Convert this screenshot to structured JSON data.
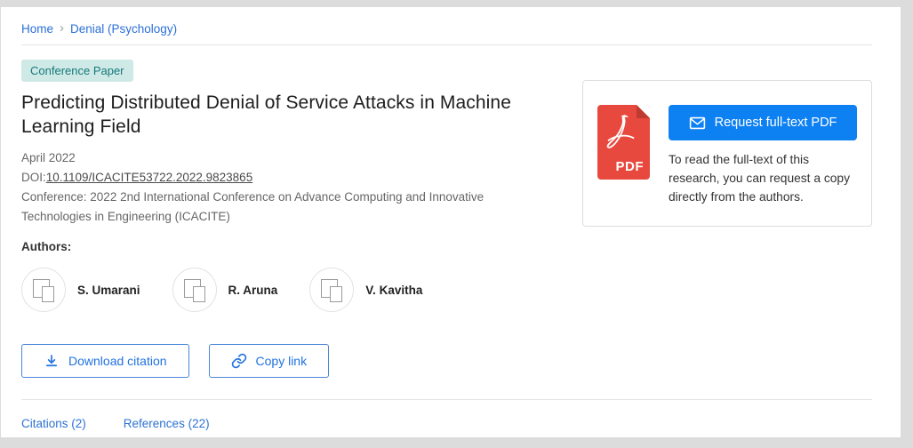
{
  "colors": {
    "link_blue": "#2b6fd8",
    "button_blue": "#0d80f2",
    "badge_bg": "#cfe9e6",
    "badge_text": "#15797b",
    "pdf_red": "#e8493e"
  },
  "breadcrumb": {
    "home": "Home",
    "topic": "Denial (Psychology)"
  },
  "badge": "Conference Paper",
  "paper": {
    "title": "Predicting Distributed Denial of Service Attacks in Machine Learning Field",
    "date": "April 2022",
    "doi_label": "DOI:",
    "doi": "10.1109/ICACITE53722.2022.9823865",
    "conference": "Conference: 2022 2nd International Conference on Advance Computing and Innovative Technologies in Engineering (ICACITE)"
  },
  "authors": {
    "label": "Authors:",
    "list": [
      {
        "name": "S. Umarani"
      },
      {
        "name": "R. Aruna"
      },
      {
        "name": "V. Kavitha"
      }
    ]
  },
  "actions": {
    "download_citation": "Download citation",
    "copy_link": "Copy link"
  },
  "request_panel": {
    "pdf_badge": "PDF",
    "button": "Request full-text PDF",
    "note": "To read the full-text of this research, you can request a copy directly from the authors."
  },
  "tabs": [
    {
      "label": "Citations (2)"
    },
    {
      "label": "References (22)"
    }
  ]
}
